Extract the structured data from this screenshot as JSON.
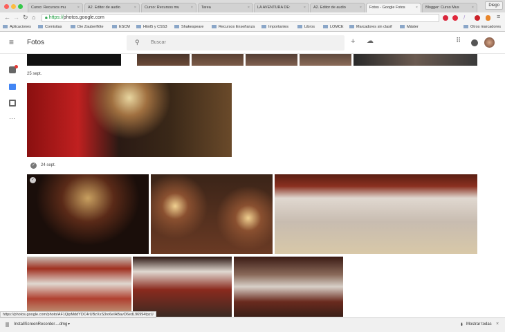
{
  "browser": {
    "tabs": [
      {
        "label": "Curso: Recursos mu",
        "active": false
      },
      {
        "label": "A2. Editor de audio",
        "active": false
      },
      {
        "label": "Curso: Recursos mu",
        "active": false
      },
      {
        "label": "Tarea",
        "active": false
      },
      {
        "label": "LA AVENTURA DE:",
        "active": false
      },
      {
        "label": "A2. Editor de audio",
        "active": false
      },
      {
        "label": "Fotos - Google Fotos",
        "active": true
      },
      {
        "label": "Blogger: Curso Mus",
        "active": false
      }
    ],
    "user": "Diego",
    "url_scheme": "https://",
    "url_rest": "photos.google.com",
    "bookmarks": [
      "Aplicaciones",
      "Cornisitas",
      "Die Zauberflöte",
      "ESCM",
      "Html5 y CSS3",
      "Shakespeare",
      "Recursos Enseñanza",
      "Importantes",
      "Libros",
      "LOMCE",
      "Marcadores sin clasif",
      "Máster"
    ],
    "other_bookmarks": "Otros marcadores"
  },
  "app": {
    "title": "Fotos",
    "search_placeholder": "Buscar",
    "sections": [
      {
        "date": "25 sept."
      },
      {
        "date": "24 sept."
      }
    ]
  },
  "status_url": "https://photos.google.com/photo/AF1QipMddYDC4rUBzXxS3ro6eIABavD6edL96994tpzU",
  "download": {
    "file": "InstallScreenRecorder....dmg",
    "show_all": "Mostrar todas"
  }
}
